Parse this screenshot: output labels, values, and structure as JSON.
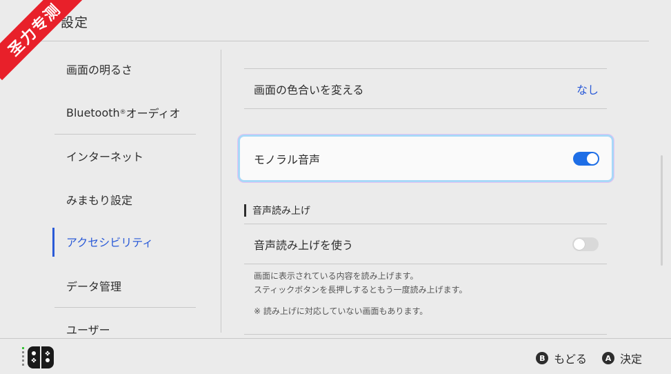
{
  "header": {
    "title": "設定",
    "icon": "gear-icon"
  },
  "watermark": "圣力专测",
  "sidebar": {
    "items": [
      {
        "label": "画面の明るさ"
      },
      {
        "label": "Bluetooth",
        "sup": "®",
        "suffix": "オーディオ"
      },
      {
        "label": "インターネット"
      },
      {
        "label": "みまもり設定"
      },
      {
        "label": "アクセシビリティ",
        "active": true
      },
      {
        "label": "データ管理"
      },
      {
        "label": "ユーザー"
      }
    ]
  },
  "main": {
    "color_row": {
      "label": "画面の色合いを変える",
      "value": "なし"
    },
    "mono_row": {
      "label": "モノラル音声",
      "toggle": "on"
    },
    "section_title": "音声読み上げ",
    "tts_row": {
      "label": "音声読み上げを使う",
      "toggle": "off"
    },
    "desc1": "画面に表示されている内容を読み上げます。",
    "desc2": "スティックボタンを長押しするともう一度読み上げます。",
    "note": "※ 読み上げに対応していない画面もあります。"
  },
  "footer": {
    "back_key": "B",
    "back_label": "もどる",
    "ok_key": "A",
    "ok_label": "決定"
  },
  "colors": {
    "accent": "#2a5ad7",
    "toggle_on": "#1e6ee6",
    "ribbon": "#e8202a"
  }
}
